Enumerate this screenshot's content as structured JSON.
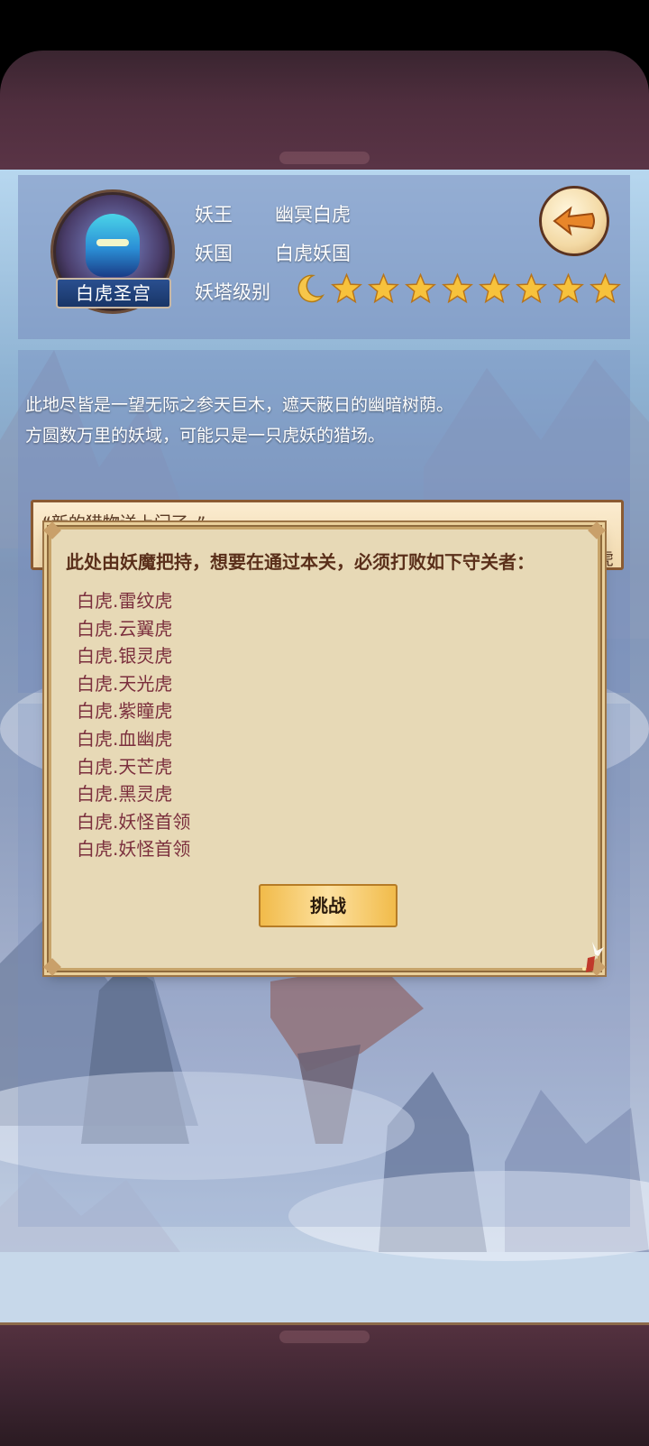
{
  "header": {
    "badge_label": "白虎圣宫",
    "rows": [
      {
        "label": "妖王",
        "value": "幽冥白虎"
      },
      {
        "label": "妖国",
        "value": "白虎妖国"
      },
      {
        "label": "妖塔级别",
        "value": ""
      }
    ],
    "tower_level": {
      "moons": 1,
      "stars": 8
    }
  },
  "description": {
    "lines": [
      "此地尽皆是一望无际之参天巨木，遮天蔽日的幽暗树荫。",
      "方圆数万里的妖域，可能只是一只虎妖的猎场。"
    ],
    "quote": "“新的猎物送上门了。”",
    "quote_tail": "虎"
  },
  "dialog": {
    "heading": "此处由妖魔把持，想要在通过本关，必须打败如下守关者：",
    "guardians": [
      "白虎.雷纹虎",
      "白虎.云翼虎",
      "白虎.银灵虎",
      "白虎.天光虎",
      "白虎.紫瞳虎",
      "白虎.血幽虎",
      "白虎.天芒虎",
      "白虎.黑灵虎",
      "白虎.妖怪首领",
      "白虎.妖怪首领"
    ],
    "challenge_label": "挑战"
  },
  "colors": {
    "frame": "#4f2e3e",
    "dialog_bg": "#e7d9b6",
    "guardian_text": "#7b2f3d",
    "button_gold": "#f1bb4a"
  },
  "icons": {
    "back": "back-arrow-icon",
    "moon": "crescent-moon-icon",
    "star": "star-icon"
  }
}
